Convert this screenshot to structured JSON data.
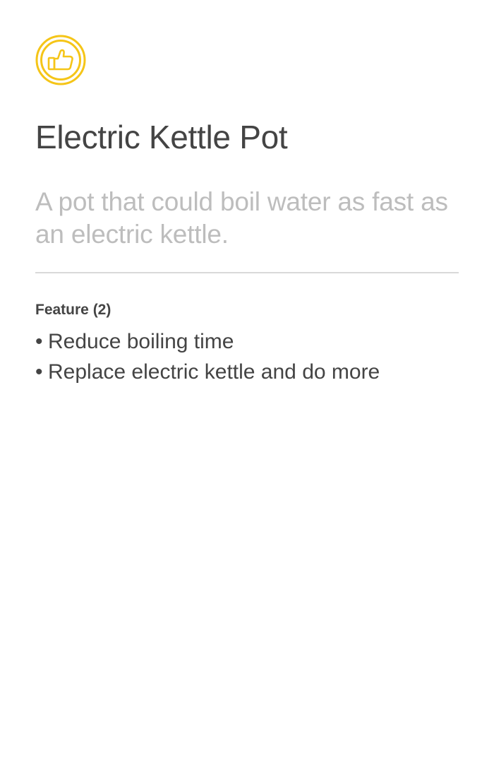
{
  "icon": {
    "name": "thumbs-up-icon",
    "color": "#F5C518"
  },
  "title": "Electric Kettle Pot",
  "description": "A pot that could boil water as fast as an electric kettle.",
  "features": {
    "heading": "Feature (2)",
    "bullet": "•",
    "items": [
      {
        "label": "Reduce boiling time"
      },
      {
        "label": "Replace electric kettle and do more"
      }
    ]
  },
  "colors": {
    "title": "#444444",
    "description": "#BDBDBD",
    "divider": "#D9D9D9",
    "accent": "#F5C518"
  }
}
